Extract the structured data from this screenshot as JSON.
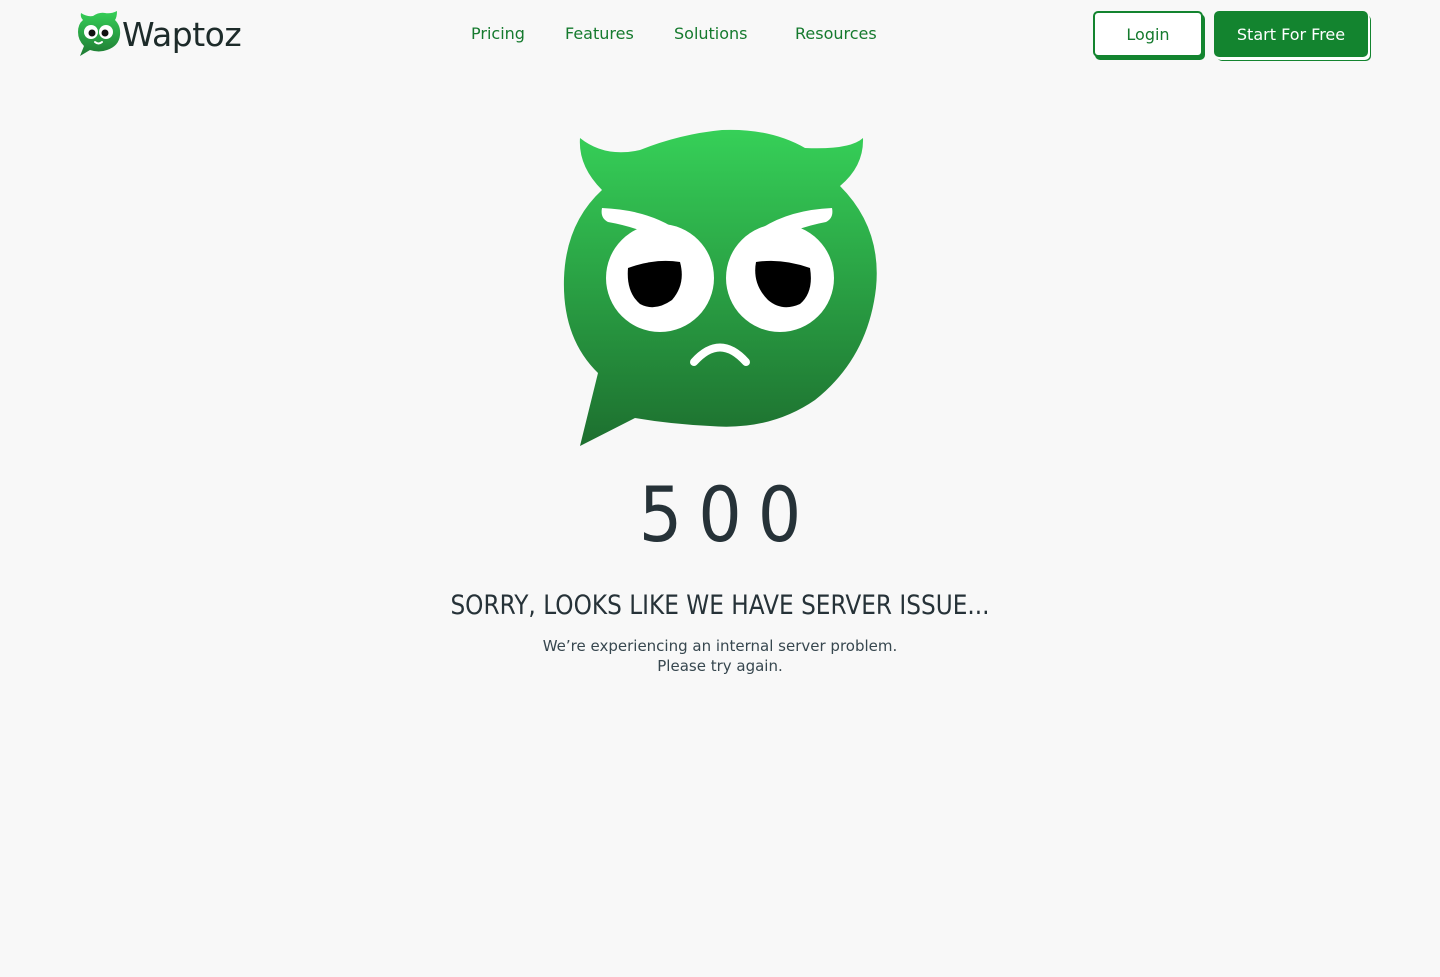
{
  "header": {
    "brand": "Waptoz",
    "logo_icon": "owl-chat-logo-icon",
    "nav": [
      {
        "label": "Pricing"
      },
      {
        "label": "Features"
      },
      {
        "label": "Solutions"
      },
      {
        "label": "Resources"
      }
    ],
    "login_label": "Login",
    "start_label": "Start For Free"
  },
  "error": {
    "illustration": "sad-owl-chat-bubble-icon",
    "code": "500",
    "title": "SORRY, LOOKS LIKE WE HAVE SERVER ISSUE...",
    "message_line1": "We’re experiencing an internal server problem.",
    "message_line2": "Please try again."
  },
  "colors": {
    "brand_green": "#13842f",
    "nav_text": "#157a2e",
    "heading_dark": "#263238",
    "background": "#f8f8f8",
    "owl_green_light": "#36d058",
    "owl_green_dark": "#1d6f2f"
  }
}
